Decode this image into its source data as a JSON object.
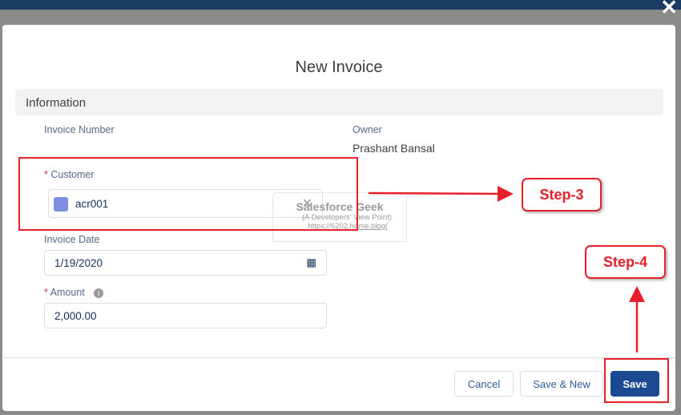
{
  "modal": {
    "title": "New Invoice",
    "section": "Information"
  },
  "fields": {
    "invoice_number_label": "Invoice Number",
    "owner_label": "Owner",
    "owner_value": "Prashant Bansal",
    "customer_label": "Customer",
    "customer_value": "acr001",
    "invoice_date_label": "Invoice Date",
    "invoice_date_value": "1/19/2020",
    "amount_label": "Amount",
    "amount_value": "2,000.00",
    "required_mark": "*"
  },
  "buttons": {
    "cancel": "Cancel",
    "save_new": "Save & New",
    "save": "Save"
  },
  "annotations": {
    "step3": "Step-3",
    "step4": "Step-4"
  },
  "watermark": {
    "title": "Salesforce Geek",
    "subtitle": "(A Developers' View Point)",
    "url": "https://6202.home.blog/"
  },
  "colors": {
    "annotation": "#e8202a",
    "primary": "#1b4a93"
  }
}
